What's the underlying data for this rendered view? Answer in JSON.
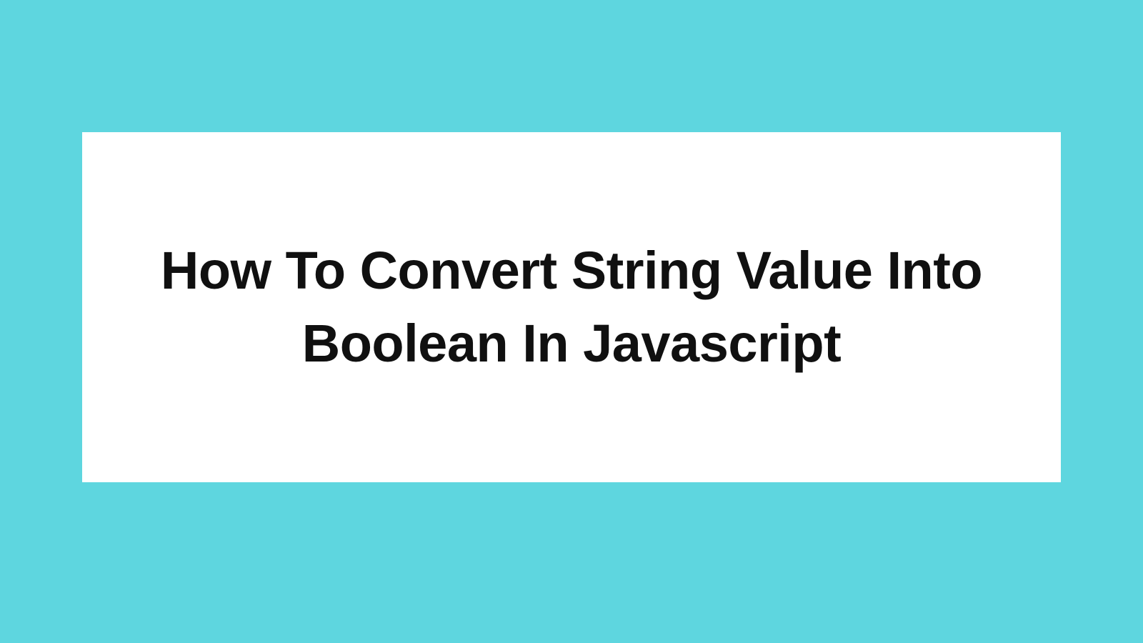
{
  "card": {
    "title": "How To Convert String Value Into Boolean In Javascript"
  },
  "colors": {
    "background": "#5ed6df",
    "card_background": "#ffffff",
    "text": "#101010"
  }
}
